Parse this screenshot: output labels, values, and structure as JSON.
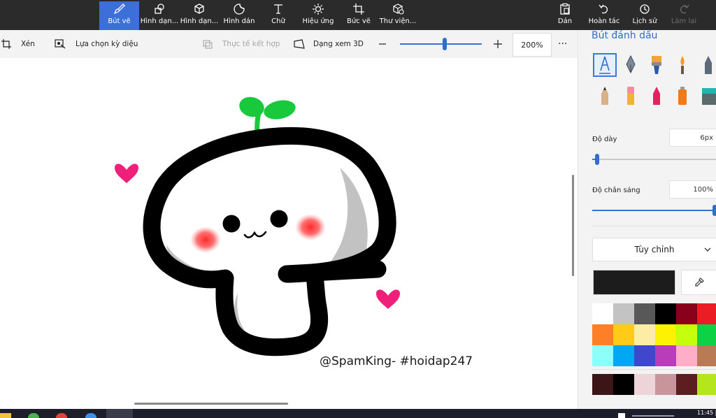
{
  "toolbar": {
    "items": [
      {
        "label": "Bút vẽ",
        "icon": "brush-icon"
      },
      {
        "label": "Hình dạn...",
        "icon": "shapes-2d-icon"
      },
      {
        "label": "Hình dạn...",
        "icon": "shapes-3d-icon"
      },
      {
        "label": "Hình dán",
        "icon": "sticker-icon"
      },
      {
        "label": "Chữ",
        "icon": "text-icon"
      },
      {
        "label": "Hiệu ứng",
        "icon": "effects-icon"
      },
      {
        "label": "Bức vẽ",
        "icon": "canvas-icon"
      },
      {
        "label": "Thư viện...",
        "icon": "library-icon"
      }
    ],
    "right": [
      {
        "label": "Dán",
        "icon": "paste-icon"
      },
      {
        "label": "Hoàn tác",
        "icon": "undo-icon"
      },
      {
        "label": "Lịch sử",
        "icon": "history-icon"
      },
      {
        "label": "Làm lại",
        "icon": "redo-icon"
      }
    ],
    "active_index": 0
  },
  "subbar": {
    "crop": "Xén",
    "magic_select": "Lựa chọn kỳ diệu",
    "mixed_reality": "Thực tế kết hợp",
    "view_3d": "Dạng xem 3D",
    "zoom_value": "200%",
    "zoom_level": 0.55,
    "more": "···"
  },
  "canvas": {
    "watermark": "@SpamKing- #hoidap247"
  },
  "panel": {
    "title": "Bút đánh dấu",
    "thickness_label": "Độ dày",
    "thickness_value": "6px",
    "thickness_level": 0.04,
    "opacity_label": "Độ chắn sáng",
    "opacity_value": "100%",
    "opacity_level": 1.0,
    "color_mode": "Tùy chỉnh",
    "current_color": "#1c1c1c",
    "palette": [
      "#ffffff",
      "#c3c3c3",
      "#585858",
      "#000000",
      "#88001b",
      "#ec1c24",
      "#ff7f27",
      "#ffca18",
      "#fdeca6",
      "#fff200",
      "#c4ff0e",
      "#0ed145",
      "#8cfffb",
      "#00a8f3",
      "#3f48cc",
      "#b83dba",
      "#ffaec8",
      "#b97a56"
    ],
    "custom_palette": [
      "#3b1518",
      "#000000",
      "#ecd4d8",
      "#c8959c",
      "#5c1e21",
      "#b5e61d"
    ]
  },
  "taskbar": {
    "clock": "11:45 |"
  }
}
